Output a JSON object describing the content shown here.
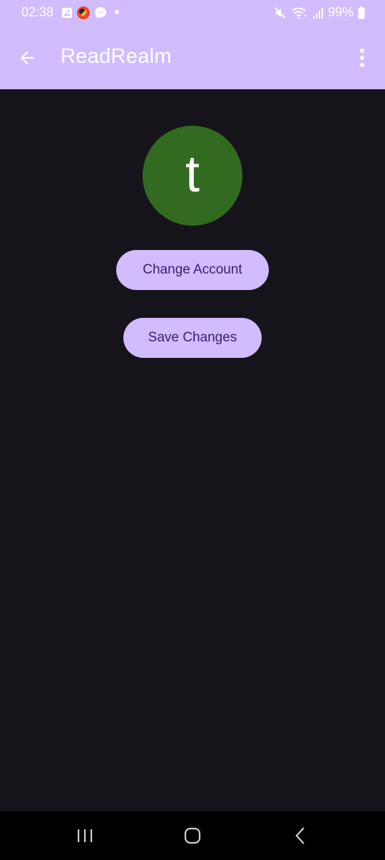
{
  "status_bar": {
    "time": "02:38",
    "battery": "99%",
    "icons": [
      "gallery-icon",
      "app-notification-icon",
      "messenger-icon",
      "dot-icon",
      "mute-icon",
      "wifi-icon",
      "signal-icon",
      "battery-icon"
    ]
  },
  "app_bar": {
    "title": "ReadRealm",
    "back_icon": "arrow-back-icon",
    "menu_icon": "more-vert-icon"
  },
  "profile": {
    "avatar_letter": "t"
  },
  "actions": {
    "change_account": "Change Account",
    "save_changes": "Save Changes"
  },
  "nav_bar": {
    "icons": [
      "recents-icon",
      "home-icon",
      "back-icon"
    ]
  },
  "colors": {
    "accent": "#d0bcff",
    "background": "#16141b",
    "avatar": "#326b20",
    "button_text": "#381e72"
  }
}
